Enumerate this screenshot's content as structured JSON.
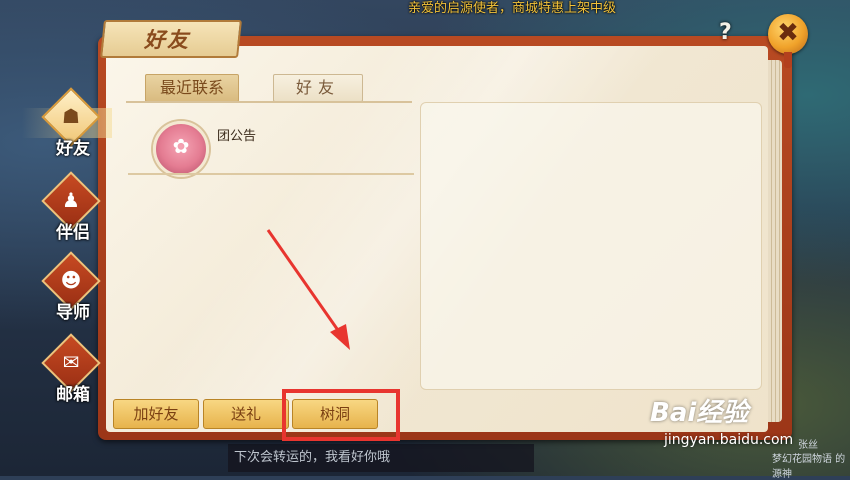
{
  "top_notice": "亲爱的启源使者，商城特惠上架中级",
  "window": {
    "title": "好友"
  },
  "icons": {
    "help": "?",
    "close": "✖"
  },
  "tabs": [
    {
      "label": "最近联系",
      "active": true
    },
    {
      "label": "好友",
      "active": false
    }
  ],
  "contacts": [
    {
      "name": "团公告"
    }
  ],
  "buttons": {
    "add_friend": "加好友",
    "gift": "送礼",
    "tree_hole": "树洞"
  },
  "sidebar": {
    "items": [
      {
        "label": "好友",
        "icon": "friend-icon",
        "active": true
      },
      {
        "label": "伴侣",
        "icon": "partner-icon",
        "active": false
      },
      {
        "label": "导师",
        "icon": "mentor-icon",
        "active": false
      },
      {
        "label": "邮箱",
        "icon": "mail-icon",
        "active": false
      }
    ]
  },
  "chat_bar": "下次会转运的，我看好你哦",
  "watermark": {
    "logo": "Bai经验",
    "url": "jingyan.baidu.com",
    "side1": "张丝",
    "side2": "梦幻花园物语 的源神"
  },
  "colors": {
    "accent": "#e8352f",
    "frame": "#b84a22",
    "button": "#e7b34c"
  }
}
